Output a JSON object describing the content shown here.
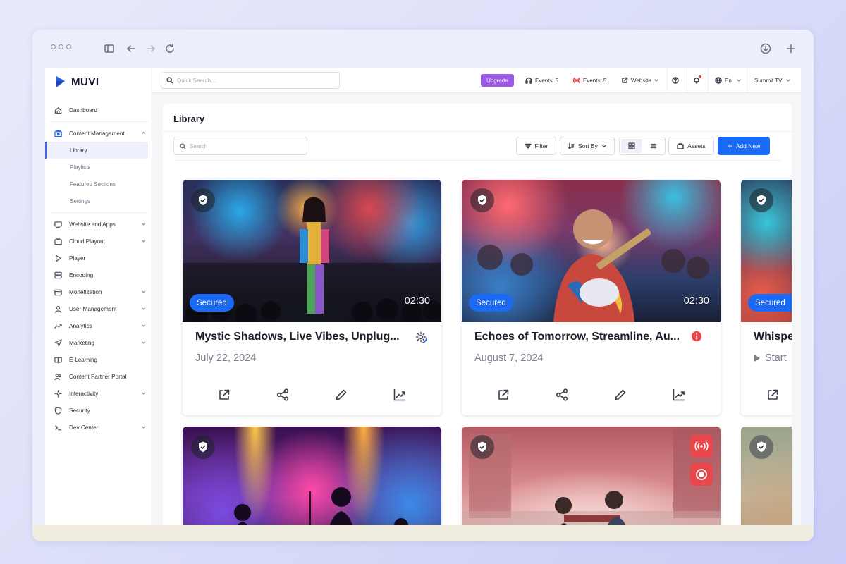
{
  "sidebar": {
    "logo_text": "MUVI",
    "items": [
      {
        "label": "Dashboard"
      },
      {
        "label": "Content Management"
      },
      {
        "label": "Website and Apps"
      },
      {
        "label": "Cloud Playout"
      },
      {
        "label": "Player"
      },
      {
        "label": "Encoding"
      },
      {
        "label": "Monetization"
      },
      {
        "label": "User Management"
      },
      {
        "label": "Analytics"
      },
      {
        "label": "Marketing"
      },
      {
        "label": "E-Learning"
      },
      {
        "label": "Content Partner Portal"
      },
      {
        "label": "Interactivity"
      },
      {
        "label": "Security"
      },
      {
        "label": "Dev Center"
      }
    ],
    "sub_items": [
      {
        "label": "Library"
      },
      {
        "label": "Playlists"
      },
      {
        "label": "Featured Sections"
      },
      {
        "label": "Settings"
      }
    ]
  },
  "topbar": {
    "search_placeholder": "Quick Search....",
    "upgrade_label": "Upgrade",
    "events_audio_label": "Events: 5",
    "events_live_label": "Events: 5",
    "website_label": "Website",
    "language_label": "En",
    "account_label": "Summit TV"
  },
  "library": {
    "title": "Library",
    "search_placeholder": "Search",
    "filter_label": "Filter",
    "sort_label": "Sort By",
    "assets_label": "Assets",
    "add_new_label": "Add New"
  },
  "cards": [
    {
      "title": "Mystic Shadows, Live Vibes, Unplug...",
      "date": "July 22, 2024",
      "badge": "Secured",
      "duration": "02:30"
    },
    {
      "title": "Echoes of Tomorrow, Streamline, Au...",
      "date": "August 7, 2024",
      "badge": "Secured",
      "duration": "02:30"
    },
    {
      "title": "Whispe",
      "date": "Start",
      "badge": "Secured"
    }
  ],
  "colors": {
    "accent": "#1a6af5",
    "upgrade": "#9b59e6",
    "live": "#e9474a"
  }
}
